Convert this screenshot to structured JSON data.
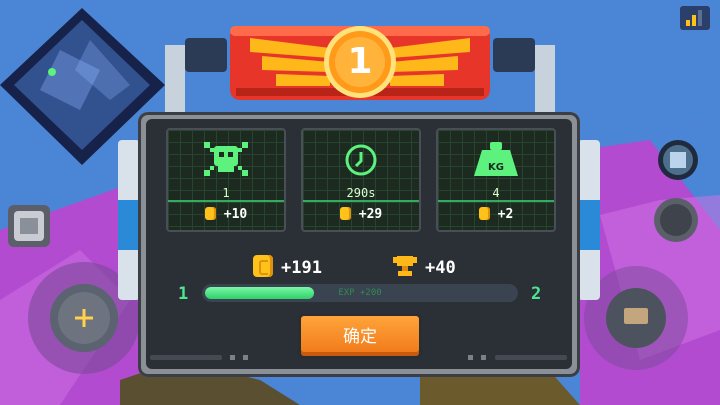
{
  "badge": {
    "rank": "1"
  },
  "stats": [
    {
      "icon": "skull-icon",
      "value": "1",
      "reward": "+10"
    },
    {
      "icon": "clock-icon",
      "value": "290s",
      "reward": "+29"
    },
    {
      "icon": "weight-icon",
      "value": "4",
      "reward": "+2",
      "weight_label": "KG"
    }
  ],
  "totals": {
    "coins": "+191",
    "trophies": "+40"
  },
  "level": {
    "current": "1",
    "next": "2",
    "exp_text": "EXP +200",
    "progress": 0.35
  },
  "confirm_label": "确定",
  "colors": {
    "accent_green": "#4de690",
    "coin": "#ffc21a",
    "button_orange": "#f58a22",
    "banner_red": "#e8352a"
  }
}
